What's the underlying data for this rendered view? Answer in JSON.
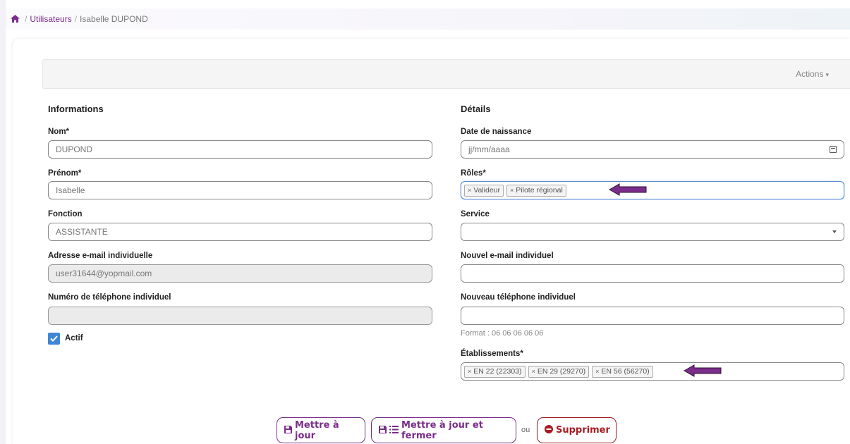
{
  "breadcrumb": {
    "home_icon": "home-icon",
    "separator": "/",
    "link": "Utilisateurs",
    "current": "Isabelle DUPOND"
  },
  "toolbar": {
    "actions_label": "Actions"
  },
  "informations": {
    "title": "Informations",
    "nom": {
      "label": "Nom*",
      "value": "DUPOND"
    },
    "prenom": {
      "label": "Prénom*",
      "value": "Isabelle"
    },
    "fonction": {
      "label": "Fonction",
      "value": "ASSISTANTE"
    },
    "email": {
      "label": "Adresse e-mail individuelle",
      "value": "user31644@yopmail.com"
    },
    "telephone": {
      "label": "Numéro de téléphone individuel",
      "value": ""
    },
    "actif": {
      "label": "Actif",
      "checked": true
    }
  },
  "details": {
    "title": "Détails",
    "date_naissance": {
      "label": "Date de naissance",
      "placeholder": "jj/mm/aaaa"
    },
    "roles": {
      "label": "Rôles*",
      "tags": [
        "Valideur",
        "Pilote régional"
      ]
    },
    "service": {
      "label": "Service",
      "value": ""
    },
    "nouvel_email": {
      "label": "Nouvel e-mail individuel",
      "value": ""
    },
    "nouveau_telephone": {
      "label": "Nouveau téléphone individuel",
      "value": "",
      "hint": "Format : 06 06 06 06 06"
    },
    "etablissements": {
      "label": "Établissements*",
      "tags": [
        "EN 22 (22303)",
        "EN 29 (29270)",
        "EN 56 (56270)"
      ]
    }
  },
  "buttons": {
    "update": "Mettre à jour",
    "update_close": "Mettre à jour et fermer",
    "or": "ou",
    "delete": "Supprimer"
  },
  "colors": {
    "accent": "#7a2d8a",
    "danger": "#a51d23",
    "checkbox": "#3f87d6",
    "annotation_arrow": "#7a2d8a"
  }
}
